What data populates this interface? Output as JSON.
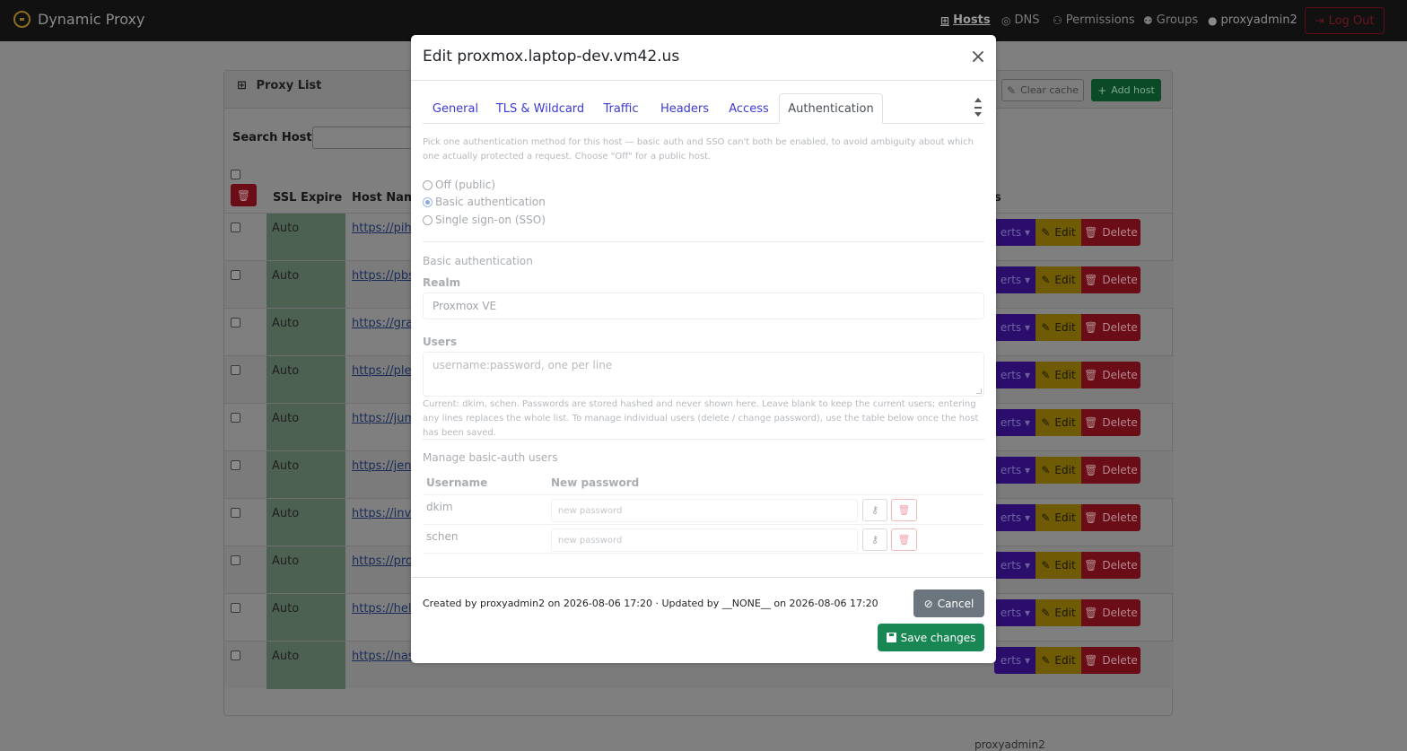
{
  "navbar": {
    "brand": "Dynamic Proxy",
    "items": [
      {
        "label": "Hosts",
        "icon": "network-icon"
      },
      {
        "label": "DNS",
        "icon": "dns-icon"
      },
      {
        "label": "Permissions",
        "icon": "user-key-icon"
      },
      {
        "label": "Groups",
        "icon": "users-icon"
      }
    ],
    "user": "proxyadmin2",
    "logout": "Log Out"
  },
  "proxy_list": {
    "title": "Proxy List",
    "clear_cache": "Clear cache",
    "add_host": "Add host",
    "search_label": "Search Hosts:",
    "col_ssl": "SSL Expire",
    "col_host": "Host Name",
    "col_actions_fragment": "s",
    "rows": [
      {
        "ssl": "Auto",
        "host": "https://piho"
      },
      {
        "ssl": "Auto",
        "host": "https://pbs."
      },
      {
        "ssl": "Auto",
        "host": "https://graf"
      },
      {
        "ssl": "Auto",
        "host": "https://plex"
      },
      {
        "ssl": "Auto",
        "host": "https://jum"
      },
      {
        "ssl": "Auto",
        "host": "https://jenk"
      },
      {
        "ssl": "Auto",
        "host": "https://invo"
      },
      {
        "ssl": "Auto",
        "host": "https://prox"
      },
      {
        "ssl": "Auto",
        "host": "https://help"
      },
      {
        "ssl": "Auto",
        "host": "https://nas."
      }
    ],
    "action_certs": "erts",
    "action_edit": "Edit",
    "action_delete": "Delete",
    "visible_creator": "proxyadmin2"
  },
  "modal": {
    "title": "Edit proxmox.laptop-dev.vm42.us",
    "tabs": [
      "General",
      "TLS & Wildcard",
      "Traffic",
      "Headers",
      "Access",
      "Authentication"
    ],
    "active_tab": "Authentication",
    "intro": "Pick one authentication method for this host — basic auth and SSO can't both be enabled, to avoid ambiguity about which one actually protected a request. Choose \"Off\" for a public host.",
    "methods": [
      {
        "label": "Off (public)",
        "checked": false
      },
      {
        "label": "Basic authentication",
        "checked": true
      },
      {
        "label": "Single sign-on (SSO)",
        "checked": false
      }
    ],
    "basic_section": "Basic authentication",
    "realm_label": "Realm",
    "realm_value": "Proxmox VE",
    "users_label": "Users",
    "users_placeholder": "username:password, one per line",
    "users_help": "Current: dkim, schen. Passwords are stored hashed and never shown here. Leave blank to keep the current users; entering any lines replaces the whole list. To manage individual users (delete / change password), use the table below once the host has been saved.",
    "manage_section": "Manage basic-auth users",
    "col_username": "Username",
    "col_new_password": "New password",
    "users": [
      {
        "username": "dkim",
        "placeholder": "new password"
      },
      {
        "username": "schen",
        "placeholder": "new password"
      }
    ],
    "footer_meta": "Created by proxyadmin2 on 2026-08-06 17:20 · Updated by __NONE__ on 2026-08-06 17:20",
    "cancel": "Cancel",
    "save": "Save changes"
  }
}
